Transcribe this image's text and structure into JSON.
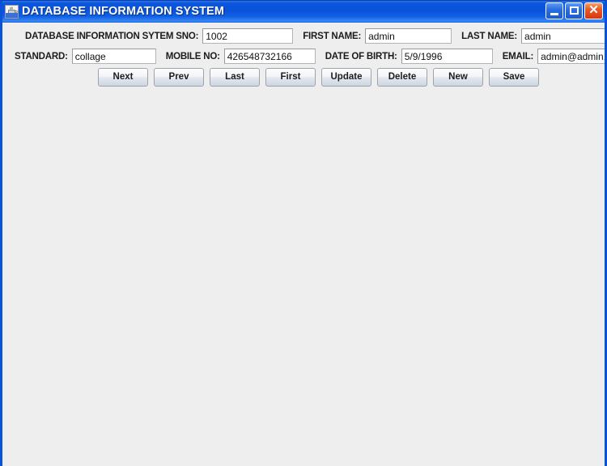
{
  "window": {
    "title": "DATABASE INFORMATION SYSTEM",
    "icon": "java-coffee-cup-icon",
    "controls": {
      "minimize": "minimize-icon",
      "maximize": "maximize-icon",
      "close": "✕"
    },
    "accent_color": "#0a52db",
    "background_color": "#eeeeee"
  },
  "form": {
    "fields": [
      {
        "label": "DATABASE INFORMATION SYTEM SNO:",
        "value": "1002",
        "placeholder": ""
      },
      {
        "label": "FIRST NAME:",
        "value": "admin",
        "placeholder": ""
      },
      {
        "label": "LAST NAME:",
        "value": "admin",
        "placeholder": ""
      },
      {
        "label": "STANDARD:",
        "value": "collage",
        "placeholder": ""
      },
      {
        "label": "MOBILE NO:",
        "value": "426548732166",
        "placeholder": ""
      },
      {
        "label": "DATE OF BIRTH:",
        "value": "5/9/1996",
        "placeholder": ""
      },
      {
        "label": "EMAIL:",
        "value": "admin@admin.com",
        "placeholder": ""
      }
    ]
  },
  "buttons": [
    {
      "label": "Next"
    },
    {
      "label": "Prev"
    },
    {
      "label": "Last"
    },
    {
      "label": "First"
    },
    {
      "label": "Update"
    },
    {
      "label": "Delete"
    },
    {
      "label": "New"
    },
    {
      "label": "Save"
    }
  ]
}
